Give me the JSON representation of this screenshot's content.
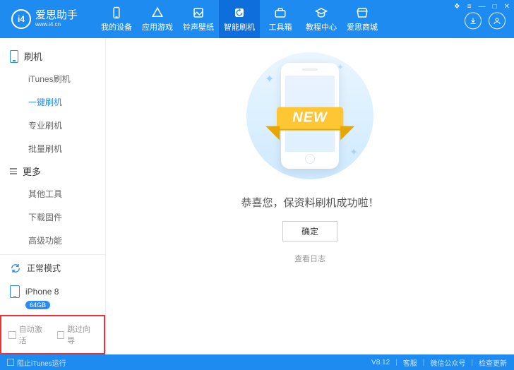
{
  "brand": {
    "name": "爱思助手",
    "url": "www.i4.cn",
    "logo": "i4"
  },
  "nav": [
    {
      "label": "我的设备"
    },
    {
      "label": "应用游戏"
    },
    {
      "label": "铃声壁纸"
    },
    {
      "label": "智能刷机"
    },
    {
      "label": "工具箱"
    },
    {
      "label": "教程中心"
    },
    {
      "label": "爱思商城"
    }
  ],
  "nav_active_index": 3,
  "sidebar": {
    "section1_title": "刷机",
    "section2_title": "更多",
    "items1": [
      {
        "label": "iTunes刷机"
      },
      {
        "label": "一键刷机"
      },
      {
        "label": "专业刷机"
      },
      {
        "label": "批量刷机"
      }
    ],
    "items1_active_index": 1,
    "items2": [
      {
        "label": "其他工具"
      },
      {
        "label": "下载固件"
      },
      {
        "label": "高级功能"
      }
    ],
    "mode": "正常模式",
    "device_name": "iPhone 8",
    "device_capacity": "64GB",
    "chk_auto_activate": "自动激活",
    "chk_skip_guide": "跳过向导"
  },
  "content": {
    "ribbon": "NEW",
    "message": "恭喜您，保资料刷机成功啦！",
    "ok": "确定",
    "view_log": "查看日志"
  },
  "statusbar": {
    "block_itunes": "阻止iTunes运行",
    "version": "V8.12",
    "support": "客服",
    "wechat": "微信公众号",
    "check_update": "检查更新"
  }
}
